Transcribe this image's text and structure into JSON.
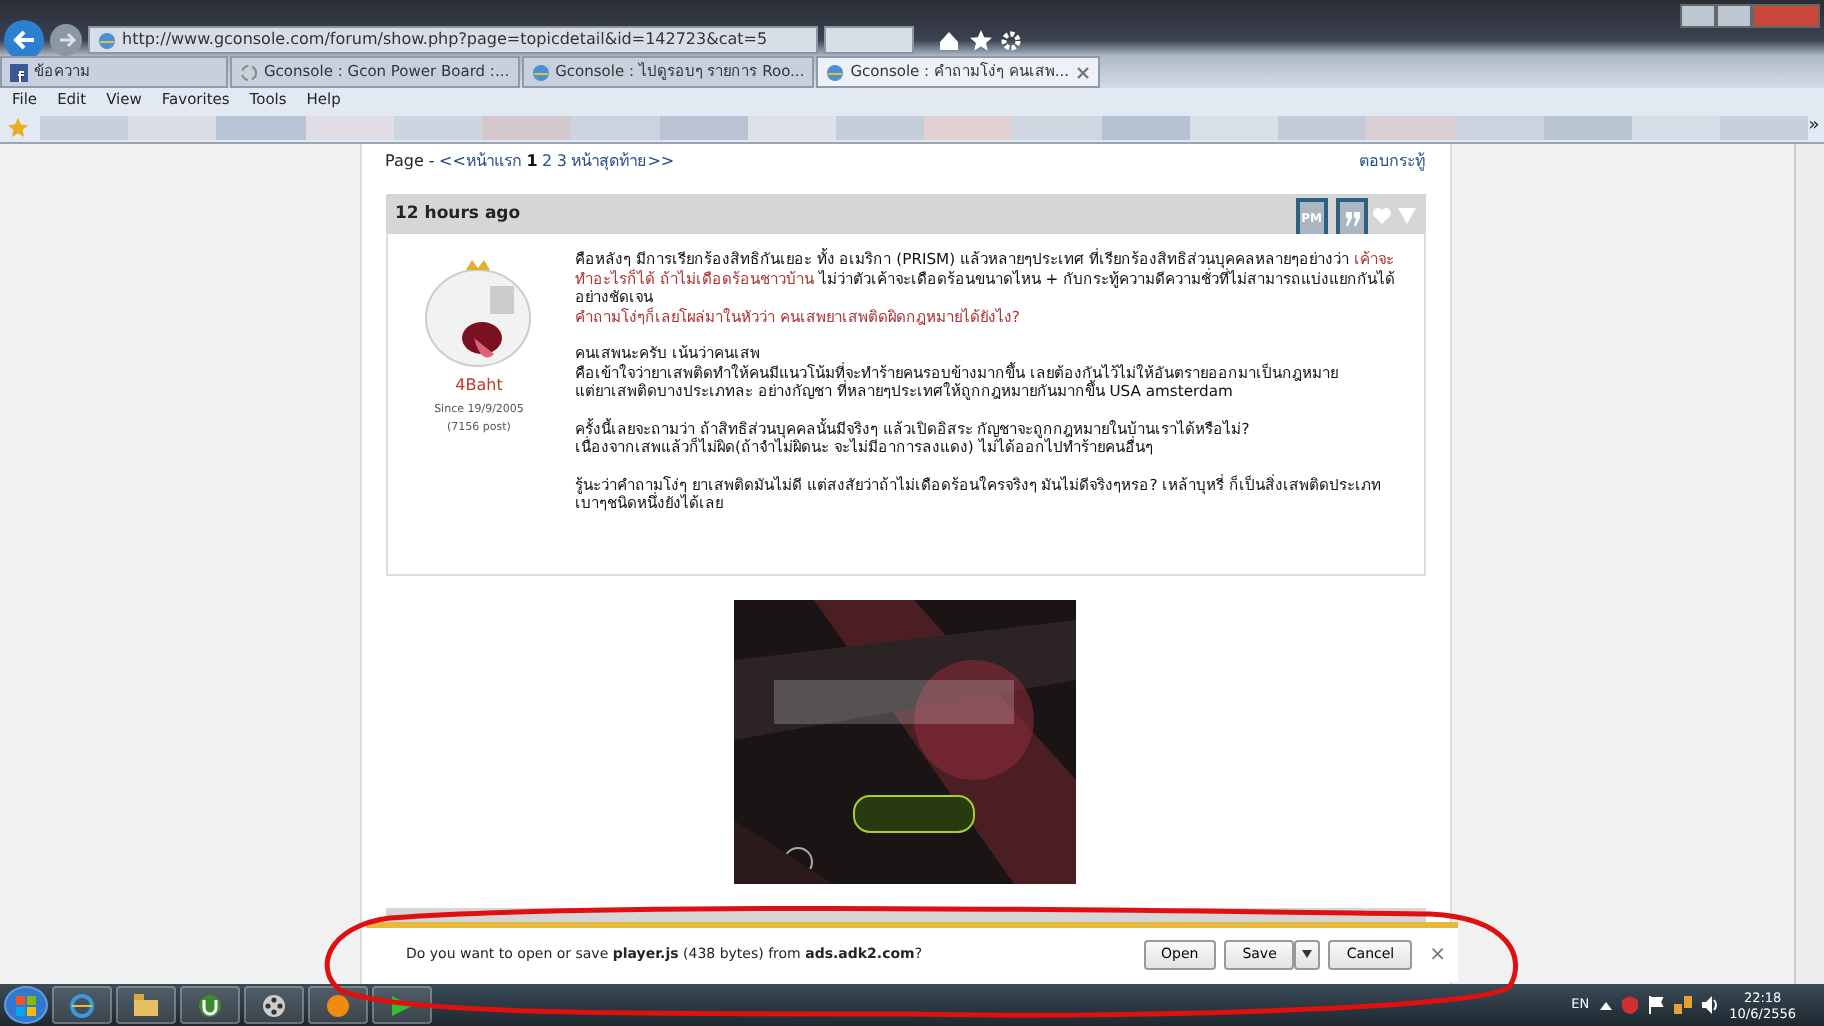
{
  "browser": {
    "address": "http://www.gconsole.com/forum/show.php?page=topicdetail&id=142723&cat=5",
    "tabs": [
      {
        "label": "ข้อความ",
        "selected": false,
        "kind": "facebook"
      },
      {
        "label": "Gconsole : Gcon Power Board :...",
        "selected": false,
        "kind": "loading"
      },
      {
        "label": "Gconsole : ไปดูรอบๆ รายการ Roo...",
        "selected": false,
        "kind": "page"
      },
      {
        "label": "Gconsole : คำถามโง่ๆ คนเสพ...",
        "selected": true,
        "kind": "page"
      }
    ],
    "menu": [
      "File",
      "Edit",
      "View",
      "Favorites",
      "Tools",
      "Help"
    ],
    "favorites_more": "»"
  },
  "pagination": {
    "prefix": "Page - ",
    "links": [
      {
        "label": "<<หน้าแรก",
        "selected": false
      },
      {
        "label": "1",
        "selected": true
      },
      {
        "label": "2",
        "selected": false
      },
      {
        "label": "3",
        "selected": false
      },
      {
        "label": "หน้าสุดท้าย>>",
        "selected": false
      }
    ],
    "reply": "ตอบกระทู้"
  },
  "post": {
    "time": "12 hours ago",
    "pm": "PM",
    "author": {
      "name": "4Baht",
      "since": "Since 19/9/2005",
      "posts": "(7156 post)"
    },
    "paragraphs": [
      [
        [
          {
            "text": "คือหลังๆ มีการเรียกร้องสิทธิกันเยอะ ทั้ง อเมริกา (PRISM) แล้วหลายๆประเทศ ที่เรียกร้องสิทธิส่วนบุคคลหลายๆอย่างว่า ",
            "highlight": false
          },
          {
            "text": "เค้าจะทำอะไรก็ได้ ถ้าไม่เดือดร้อนชาวบ้าน",
            "highlight": true
          },
          {
            "text": " ไม่ว่าตัวเค้าจะเดือดร้อนขนาดไหน + กับกระทู้ความดีความชั่วที่ไม่สามารถแบ่งแยกกันได้อย่างชัดเจน",
            "highlight": false
          }
        ],
        [
          {
            "text": "คำถามโง่ๆก็เลยโผล่มาในหัวว่า คนเสพยาเสพติดผิดกฎหมายได้ยังไง?",
            "highlight": true
          }
        ]
      ],
      [
        [
          {
            "text": "คนเสพนะครับ เน้นว่าคนเสพ",
            "highlight": false
          }
        ],
        [
          {
            "text": "คือเข้าใจว่ายาเสพติดทำให้คนมีแนวโน้มที่จะทำร้ายคนรอบข้างมากขึ้น เลยต้องกันไว้ไม่ให้อันตรายออกมาเป็นกฎหมาย",
            "highlight": false
          }
        ],
        [
          {
            "text": "แต่ยาเสพติดบางประเภทละ อย่างกัญชา ที่หลายๆประเทศให้ถูกกฎหมายกันมากขึ้น USA amsterdam",
            "highlight": false
          }
        ]
      ],
      [
        [
          {
            "text": "ครั้งนี้เลยจะถามว่า ถ้าสิทธิส่วนบุคคลนั้นมีจริงๆ แล้วเปิดอิสระ กัญชาจะถูกกฎหมายในบ้านเราได้หรือไม่?",
            "highlight": false
          }
        ],
        [
          {
            "text": "เนื่องจากเสพแล้วก็ไม่ผิด(ถ้าจำไม่ผิดนะ จะไม่มีอาการลงแดง) ไม่ได้ออกไปทำร้ายคนอื่นๆ",
            "highlight": false
          }
        ]
      ],
      [
        [
          {
            "text": "รู้นะว่าคำถามโง่ๆ ยาเสพติดมันไม่ดี แต่สงสัยว่าถ้าไม่เดือดร้อนใครจริงๆ มันไม่ดีจริงๆหรอ? เหล้าบุหรี่ ก็เป็นสิ่งเสพติดประเภทเบาๆชนิดหนึ่งยังได้เลย",
            "highlight": false
          }
        ]
      ]
    ]
  },
  "download_bar": {
    "message": "Do you want to open or save **player.js** (438 bytes) from **ads.adk2.com**?",
    "buttons": [
      {
        "label": "Open",
        "kind": "plain"
      },
      {
        "label": "Save",
        "kind": "split"
      },
      {
        "label": "Cancel",
        "kind": "plain"
      }
    ],
    "close": "×"
  },
  "taskbar": {
    "language": "EN",
    "time": "22:18",
    "date": "10/6/2556"
  }
}
